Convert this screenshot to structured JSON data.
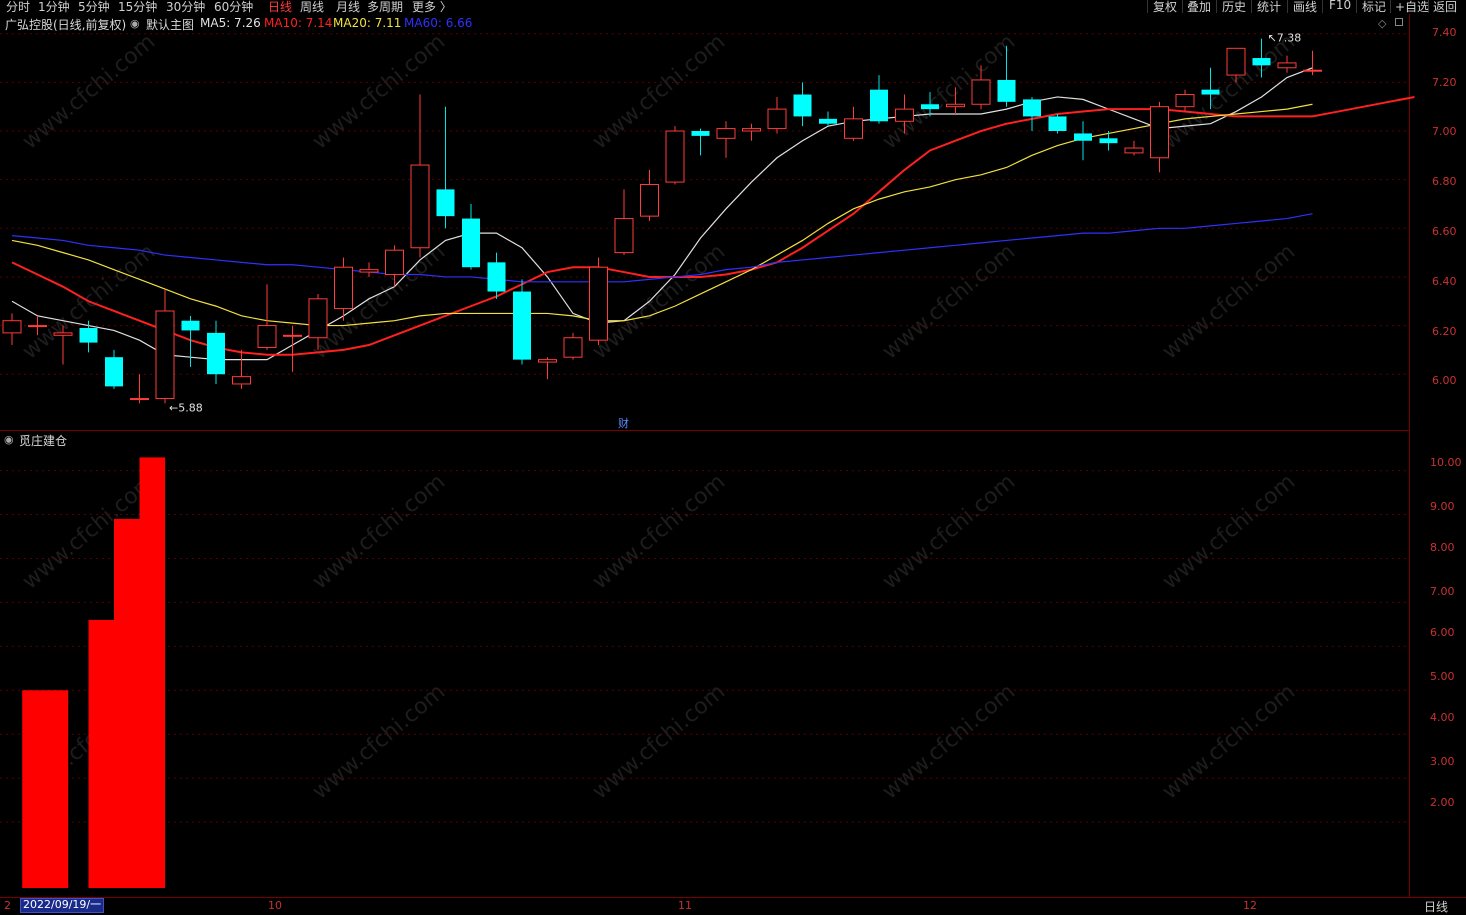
{
  "toolbar": {
    "periods": [
      "分时",
      "1分钟",
      "5分钟",
      "15分钟",
      "30分钟",
      "60分钟",
      "日线",
      "周线",
      "月线",
      "多周期",
      "更多 〉"
    ],
    "active_period": "日线",
    "tools": [
      "复权",
      "叠加",
      "历史",
      "统计",
      "画线",
      "F10",
      "标记",
      "+自选",
      "返回"
    ]
  },
  "main_chart": {
    "title": "广弘控股(日线,前复权)",
    "template": "默认主图",
    "ma": [
      {
        "label": "MA5: 7.26",
        "color": "#e0e0e0"
      },
      {
        "label": "MA10: 7.14",
        "color": "#ff2020"
      },
      {
        "label": "MA20: 7.11",
        "color": "#f0e040"
      },
      {
        "label": "MA60: 6.66",
        "color": "#3030ff"
      }
    ],
    "y_ticks": [
      "7.40",
      "7.20",
      "7.00",
      "6.80",
      "6.60",
      "6.40",
      "6.20",
      "6.00"
    ],
    "high_marker": "7.38",
    "low_marker": "5.88",
    "finance_marker": "财"
  },
  "sub_chart": {
    "title": "觅庄建仓",
    "y_ticks": [
      "10.00",
      "9.00",
      "8.00",
      "7.00",
      "6.00",
      "5.00",
      "4.00",
      "3.00",
      "2.00"
    ]
  },
  "x_axis": {
    "cursor_date": "2022/09/19/一",
    "first_digit": "2",
    "month_labels": [
      "10",
      "11",
      "12"
    ],
    "period_label": "日线"
  },
  "watermark": "www.cfchi.com",
  "chart_data": [
    {
      "type": "candlestick",
      "title": "广弘控股(日线,前复权)",
      "ylim": [
        5.82,
        7.44
      ],
      "candles": [
        {
          "o": 6.17,
          "c": 6.22,
          "h": 6.25,
          "l": 6.12
        },
        {
          "o": 6.2,
          "c": 6.2,
          "h": 6.24,
          "l": 6.16
        },
        {
          "o": 6.16,
          "c": 6.17,
          "h": 6.2,
          "l": 6.04
        },
        {
          "o": 6.19,
          "c": 6.13,
          "h": 6.22,
          "l": 6.09
        },
        {
          "o": 6.07,
          "c": 5.95,
          "h": 6.1,
          "l": 5.94
        },
        {
          "o": 5.9,
          "c": 5.9,
          "h": 6.0,
          "l": 5.88
        },
        {
          "o": 5.9,
          "c": 6.26,
          "h": 6.35,
          "l": 5.88
        },
        {
          "o": 6.22,
          "c": 6.18,
          "h": 6.24,
          "l": 6.03
        },
        {
          "o": 6.17,
          "c": 6.0,
          "h": 6.22,
          "l": 5.96
        },
        {
          "o": 5.96,
          "c": 5.99,
          "h": 6.1,
          "l": 5.94
        },
        {
          "o": 6.11,
          "c": 6.2,
          "h": 6.37,
          "l": 6.1
        },
        {
          "o": 6.16,
          "c": 6.16,
          "h": 6.2,
          "l": 6.01
        },
        {
          "o": 6.15,
          "c": 6.31,
          "h": 6.33,
          "l": 6.1
        },
        {
          "o": 6.27,
          "c": 6.44,
          "h": 6.48,
          "l": 6.22
        },
        {
          "o": 6.42,
          "c": 6.43,
          "h": 6.46,
          "l": 6.4
        },
        {
          "o": 6.41,
          "c": 6.51,
          "h": 6.53,
          "l": 6.36
        },
        {
          "o": 6.52,
          "c": 6.86,
          "h": 7.15,
          "l": 6.48
        },
        {
          "o": 6.76,
          "c": 6.65,
          "h": 7.1,
          "l": 6.6
        },
        {
          "o": 6.64,
          "c": 6.44,
          "h": 6.7,
          "l": 6.43
        },
        {
          "o": 6.46,
          "c": 6.34,
          "h": 6.5,
          "l": 6.31
        },
        {
          "o": 6.34,
          "c": 6.06,
          "h": 6.39,
          "l": 6.04
        },
        {
          "o": 6.05,
          "c": 6.06,
          "h": 6.07,
          "l": 5.98
        },
        {
          "o": 6.07,
          "c": 6.15,
          "h": 6.17,
          "l": 6.06
        },
        {
          "o": 6.14,
          "c": 6.44,
          "h": 6.48,
          "l": 6.12
        },
        {
          "o": 6.5,
          "c": 6.64,
          "h": 6.76,
          "l": 6.49
        },
        {
          "o": 6.65,
          "c": 6.78,
          "h": 6.84,
          "l": 6.63
        },
        {
          "o": 6.79,
          "c": 7.0,
          "h": 7.02,
          "l": 6.78
        },
        {
          "o": 7.0,
          "c": 6.98,
          "h": 7.01,
          "l": 6.9
        },
        {
          "o": 6.97,
          "c": 7.01,
          "h": 7.04,
          "l": 6.89
        },
        {
          "o": 7.0,
          "c": 7.01,
          "h": 7.03,
          "l": 6.96
        },
        {
          "o": 7.01,
          "c": 7.09,
          "h": 7.14,
          "l": 6.99
        },
        {
          "o": 7.15,
          "c": 7.06,
          "h": 7.2,
          "l": 7.02
        },
        {
          "o": 7.05,
          "c": 7.03,
          "h": 7.08,
          "l": 7.02
        },
        {
          "o": 6.97,
          "c": 7.05,
          "h": 7.1,
          "l": 6.96
        },
        {
          "o": 7.17,
          "c": 7.04,
          "h": 7.23,
          "l": 7.03
        },
        {
          "o": 7.04,
          "c": 7.09,
          "h": 7.15,
          "l": 6.99
        },
        {
          "o": 7.11,
          "c": 7.09,
          "h": 7.16,
          "l": 7.06
        },
        {
          "o": 7.1,
          "c": 7.11,
          "h": 7.18,
          "l": 7.07
        },
        {
          "o": 7.11,
          "c": 7.21,
          "h": 7.27,
          "l": 7.09
        },
        {
          "o": 7.21,
          "c": 7.12,
          "h": 7.35,
          "l": 7.1
        },
        {
          "o": 7.13,
          "c": 7.06,
          "h": 7.14,
          "l": 7.0
        },
        {
          "o": 7.06,
          "c": 7.0,
          "h": 7.07,
          "l": 6.99
        },
        {
          "o": 6.99,
          "c": 6.96,
          "h": 7.04,
          "l": 6.88
        },
        {
          "o": 6.97,
          "c": 6.95,
          "h": 7.0,
          "l": 6.92
        },
        {
          "o": 6.91,
          "c": 6.93,
          "h": 6.96,
          "l": 6.9
        },
        {
          "o": 6.89,
          "c": 7.1,
          "h": 7.12,
          "l": 6.83
        },
        {
          "o": 7.1,
          "c": 7.15,
          "h": 7.17,
          "l": 7.08
        },
        {
          "o": 7.17,
          "c": 7.15,
          "h": 7.26,
          "l": 7.09
        },
        {
          "o": 7.23,
          "c": 7.34,
          "h": 7.34,
          "l": 7.2
        },
        {
          "o": 7.3,
          "c": 7.27,
          "h": 7.38,
          "l": 7.22
        },
        {
          "o": 7.26,
          "c": 7.28,
          "h": 7.31,
          "l": 7.24
        },
        {
          "o": 7.25,
          "c": 7.25,
          "h": 7.33,
          "l": 7.23
        }
      ],
      "series": [
        {
          "name": "MA5",
          "color": "#e0e0e0",
          "values": [
            6.3,
            6.24,
            6.22,
            6.2,
            6.18,
            6.14,
            6.08,
            6.07,
            6.06,
            6.06,
            6.06,
            6.12,
            6.18,
            6.24,
            6.31,
            6.36,
            6.47,
            6.55,
            6.58,
            6.58,
            6.52,
            6.4,
            6.25,
            6.21,
            6.22,
            6.3,
            6.41,
            6.56,
            6.68,
            6.79,
            6.89,
            6.96,
            7.02,
            7.04,
            7.05,
            7.06,
            7.07,
            7.07,
            7.07,
            7.09,
            7.12,
            7.14,
            7.13,
            7.09,
            7.05,
            7.01,
            7.02,
            7.03,
            7.08,
            7.14,
            7.22,
            7.26
          ]
        },
        {
          "name": "MA10",
          "color": "#ff2020",
          "values": [
            6.46,
            6.41,
            6.36,
            6.3,
            6.26,
            6.22,
            6.18,
            6.14,
            6.11,
            6.09,
            6.08,
            6.08,
            6.09,
            6.1,
            6.12,
            6.16,
            6.2,
            6.24,
            6.28,
            6.32,
            6.37,
            6.42,
            6.44,
            6.44,
            6.42,
            6.4,
            6.4,
            6.4,
            6.41,
            6.43,
            6.46,
            6.52,
            6.59,
            6.66,
            6.75,
            6.84,
            6.92,
            6.96,
            7.0,
            7.03,
            7.05,
            7.07,
            7.08,
            7.09,
            7.09,
            7.09,
            7.08,
            7.07,
            7.06,
            7.06,
            7.06,
            7.06,
            7.08,
            7.1,
            7.12,
            7.14
          ]
        },
        {
          "name": "MA20",
          "color": "#f0e040",
          "values": [
            6.55,
            6.53,
            6.5,
            6.47,
            6.43,
            6.39,
            6.35,
            6.31,
            6.28,
            6.24,
            6.22,
            6.21,
            6.2,
            6.2,
            6.21,
            6.22,
            6.24,
            6.25,
            6.25,
            6.25,
            6.25,
            6.25,
            6.24,
            6.22,
            6.22,
            6.24,
            6.28,
            6.33,
            6.38,
            6.43,
            6.49,
            6.55,
            6.62,
            6.68,
            6.72,
            6.75,
            6.77,
            6.8,
            6.82,
            6.85,
            6.9,
            6.94,
            6.97,
            6.99,
            7.01,
            7.03,
            7.05,
            7.06,
            7.07,
            7.08,
            7.09,
            7.11
          ]
        },
        {
          "name": "MA60",
          "color": "#3030ff",
          "values": [
            6.57,
            6.56,
            6.55,
            6.53,
            6.52,
            6.51,
            6.49,
            6.48,
            6.47,
            6.46,
            6.45,
            6.45,
            6.44,
            6.43,
            6.42,
            6.41,
            6.41,
            6.4,
            6.4,
            6.39,
            6.38,
            6.38,
            6.38,
            6.38,
            6.38,
            6.39,
            6.4,
            6.41,
            6.43,
            6.44,
            6.46,
            6.47,
            6.48,
            6.49,
            6.5,
            6.51,
            6.52,
            6.53,
            6.54,
            6.55,
            6.56,
            6.57,
            6.58,
            6.58,
            6.59,
            6.6,
            6.6,
            6.61,
            6.62,
            6.63,
            6.64,
            6.66
          ]
        }
      ]
    },
    {
      "type": "bar",
      "title": "觅庄建仓",
      "ylim": [
        0.5,
        10.4
      ],
      "color": "#ff0000",
      "bars": [
        {
          "index": 1.5,
          "value": 5.0
        },
        {
          "index": 3.5,
          "value": 6.6
        },
        {
          "index": 4.5,
          "value": 8.9
        },
        {
          "index": 5.5,
          "value": 10.3
        }
      ]
    }
  ]
}
